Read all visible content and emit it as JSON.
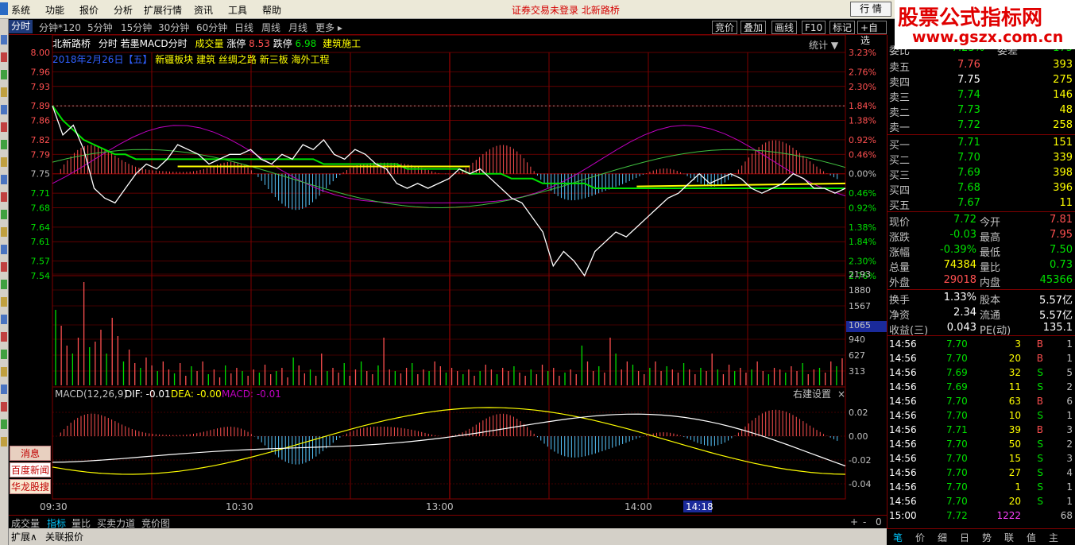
{
  "menu": {
    "items": [
      "系统",
      "功能",
      "报价",
      "分析",
      "扩展行情",
      "资讯",
      "工具",
      "帮助"
    ],
    "status": "证券交易未登录   北新路桥",
    "quote_button": "行 情"
  },
  "watermark": {
    "title": "股票公式指标网",
    "url": "www.gszx.com.cn"
  },
  "toolbar": {
    "periods": [
      "分时",
      "分钟*120",
      "5分钟",
      "15分钟",
      "30分钟",
      "60分钟",
      "日线",
      "周线",
      "月线",
      "更多 ▸"
    ],
    "right_buttons": [
      "竞价",
      "叠加",
      "画线",
      "F10",
      "标记",
      "+自选"
    ]
  },
  "info": {
    "stock_name": "北新路桥",
    "title": "分时 若墨MACD分时",
    "volume_label": "成交量",
    "limit_up_label": "涨停",
    "limit_up": "8.53",
    "limit_down_label": "跌停",
    "limit_down": "6.98",
    "sector": "建筑施工",
    "stats": "统计 ▼",
    "date_line": "2018年2月26日【五】",
    "concepts": "新疆板块 建筑    丝绸之路 新三板 海外工程"
  },
  "axes": {
    "price_ticks": [
      "8.00",
      "7.96",
      "7.93",
      "7.89",
      "7.86",
      "7.82",
      "7.79",
      "7.75",
      "7.71",
      "7.68",
      "7.64",
      "7.61",
      "7.57",
      "7.54"
    ],
    "pct_ticks": [
      "3.23%",
      "2.76%",
      "2.30%",
      "1.84%",
      "1.38%",
      "0.92%",
      "0.46%",
      "0.00%",
      "0.46%",
      "0.92%",
      "1.38%",
      "1.84%",
      "2.30%",
      "2.76%"
    ],
    "vol_ticks": [
      "2193",
      "1880",
      "1567",
      "1065",
      "940",
      "627",
      "313"
    ],
    "vol_highlight": "1065",
    "macd_ticks": [
      "0.02",
      "0.00",
      "-0.02",
      "-0.04"
    ],
    "time_ticks": [
      "09:30",
      "10:30",
      "13:00",
      "14:00"
    ],
    "time_cursor": "14:18"
  },
  "macd": {
    "label": "MACD(12,26,9)",
    "dif": "DIF: -0.01",
    "dea": "DEA: -0.00",
    "macd": "MACD: -0.01",
    "settings": "右建设置",
    "close": "×"
  },
  "left_ads": [
    "消息",
    "百度新闻",
    "华龙股搜"
  ],
  "bottom_tabs": [
    "成交量",
    "指标",
    "量比",
    "买卖力道",
    "竞价图"
  ],
  "bottom_controls": [
    "+",
    "-",
    "0"
  ],
  "bottom_bar": [
    "扩展∧",
    "关联报价"
  ],
  "quote": {
    "top_partial": {
      "l": "委比",
      "v": "-7.23%",
      "l2": "委差",
      "v2": "-175"
    },
    "asks": [
      {
        "l": "卖五",
        "p": "7.76",
        "v": "393"
      },
      {
        "l": "卖四",
        "p": "7.75",
        "v": "275"
      },
      {
        "l": "卖三",
        "p": "7.74",
        "v": "146"
      },
      {
        "l": "卖二",
        "p": "7.73",
        "v": "48"
      },
      {
        "l": "卖一",
        "p": "7.72",
        "v": "258"
      }
    ],
    "bids": [
      {
        "l": "买一",
        "p": "7.71",
        "v": "151"
      },
      {
        "l": "买二",
        "p": "7.70",
        "v": "339"
      },
      {
        "l": "买三",
        "p": "7.69",
        "v": "398"
      },
      {
        "l": "买四",
        "p": "7.68",
        "v": "396"
      },
      {
        "l": "买五",
        "p": "7.67",
        "v": "11"
      }
    ],
    "stats": [
      {
        "l1": "现价",
        "v1": "7.72",
        "l2": "今开",
        "v2": "7.81"
      },
      {
        "l1": "涨跌",
        "v1": "-0.03",
        "l2": "最高",
        "v2": "7.95"
      },
      {
        "l1": "涨幅",
        "v1": "-0.39%",
        "l2": "最低",
        "v2": "7.50"
      },
      {
        "l1": "总量",
        "v1": "74384",
        "l2": "量比",
        "v2": "0.73"
      },
      {
        "l1": "外盘",
        "v1": "29018",
        "l2": "内盘",
        "v2": "45366"
      }
    ],
    "stats2": [
      {
        "l1": "换手",
        "v1": "1.33%",
        "l2": "股本",
        "v2": "5.57亿"
      },
      {
        "l1": "净资",
        "v1": "2.34",
        "l2": "流通",
        "v2": "5.57亿"
      },
      {
        "l1": "收益(三)",
        "v1": "0.043",
        "l2": "PE(动)",
        "v2": "135.1"
      }
    ]
  },
  "ticks": [
    {
      "t": "14:56",
      "p": "7.70",
      "v": "3",
      "d": "B",
      "n": "1"
    },
    {
      "t": "14:56",
      "p": "7.70",
      "v": "20",
      "d": "B",
      "n": "1"
    },
    {
      "t": "14:56",
      "p": "7.69",
      "v": "32",
      "d": "S",
      "n": "5"
    },
    {
      "t": "14:56",
      "p": "7.69",
      "v": "11",
      "d": "S",
      "n": "2"
    },
    {
      "t": "14:56",
      "p": "7.70",
      "v": "63",
      "d": "B",
      "n": "6"
    },
    {
      "t": "14:56",
      "p": "7.70",
      "v": "10",
      "d": "S",
      "n": "1"
    },
    {
      "t": "14:56",
      "p": "7.71",
      "v": "39",
      "d": "B",
      "n": "3"
    },
    {
      "t": "14:56",
      "p": "7.70",
      "v": "50",
      "d": "S",
      "n": "2"
    },
    {
      "t": "14:56",
      "p": "7.70",
      "v": "15",
      "d": "S",
      "n": "3"
    },
    {
      "t": "14:56",
      "p": "7.70",
      "v": "27",
      "d": "S",
      "n": "4"
    },
    {
      "t": "14:56",
      "p": "7.70",
      "v": "1",
      "d": "S",
      "n": "1"
    },
    {
      "t": "14:56",
      "p": "7.70",
      "v": "20",
      "d": "S",
      "n": "1"
    },
    {
      "t": "15:00",
      "p": "7.72",
      "v": "1222",
      "d": "",
      "n": "68"
    }
  ],
  "rp_tabs": [
    "笔",
    "价",
    "细",
    "日",
    "势",
    "联",
    "值",
    "主"
  ],
  "colors": {
    "up": "#ff5050",
    "down": "#00e000",
    "grid": "#800000",
    "price_line": "#ffffff",
    "avg_line": "#00e000",
    "dif_line": "#ffffff",
    "dea_line": "#ffff00",
    "macd_purple": "#c000c0"
  },
  "chart_data": {
    "type": "line",
    "title": "",
    "prev_close": 7.75,
    "price_range": [
      7.54,
      8.0
    ],
    "x_labels": [
      "09:30",
      "10:30",
      "13:00",
      "14:00"
    ],
    "series": [
      {
        "name": "",
        "values": [
          7.89,
          7.83,
          7.85,
          7.8,
          7.72,
          7.7,
          7.69,
          7.72,
          7.75,
          7.77,
          7.76,
          7.78,
          7.81,
          7.8,
          7.79,
          7.77,
          7.78,
          7.79,
          7.79,
          7.8,
          7.78,
          7.77,
          7.79,
          7.78,
          7.81,
          7.8,
          7.82,
          7.79,
          7.78,
          7.8,
          7.79,
          7.77,
          7.76,
          7.73,
          7.72,
          7.73,
          7.72,
          7.73,
          7.74,
          7.76,
          7.75,
          7.76,
          7.74,
          7.72,
          7.7,
          7.69,
          7.66,
          7.63,
          7.56,
          7.59,
          7.57,
          7.54,
          7.59,
          7.61,
          7.63,
          7.62,
          7.64,
          7.66,
          7.68,
          7.7,
          7.71,
          7.73,
          7.75,
          7.73,
          7.74,
          7.75,
          7.74,
          7.72,
          7.71,
          7.72,
          7.73,
          7.75,
          7.74,
          7.72,
          7.72,
          7.71,
          7.72
        ]
      },
      {
        "name": "",
        "values": [
          7.89,
          7.86,
          7.84,
          7.82,
          7.81,
          7.8,
          7.79,
          7.79,
          7.78,
          7.78,
          7.78,
          7.78,
          7.78,
          7.78,
          7.78,
          7.78,
          7.78,
          7.78,
          7.78,
          7.78,
          7.78,
          7.78,
          7.78,
          7.78,
          7.78,
          7.78,
          7.77,
          7.77,
          7.77,
          7.77,
          7.77,
          7.77,
          7.77,
          7.77,
          7.76,
          7.76,
          7.76,
          7.76,
          7.76,
          7.76,
          7.75,
          7.75,
          7.75,
          7.75,
          7.74,
          7.74,
          7.74,
          7.73,
          7.73,
          7.73,
          7.73,
          7.73,
          7.72,
          7.72,
          7.72,
          7.72,
          7.72,
          7.72,
          7.72,
          7.72,
          7.72,
          7.72,
          7.72,
          7.72,
          7.72,
          7.72,
          7.72,
          7.72,
          7.72,
          7.72,
          7.72,
          7.72,
          7.72,
          7.72,
          7.72,
          7.72,
          7.72
        ]
      }
    ]
  }
}
